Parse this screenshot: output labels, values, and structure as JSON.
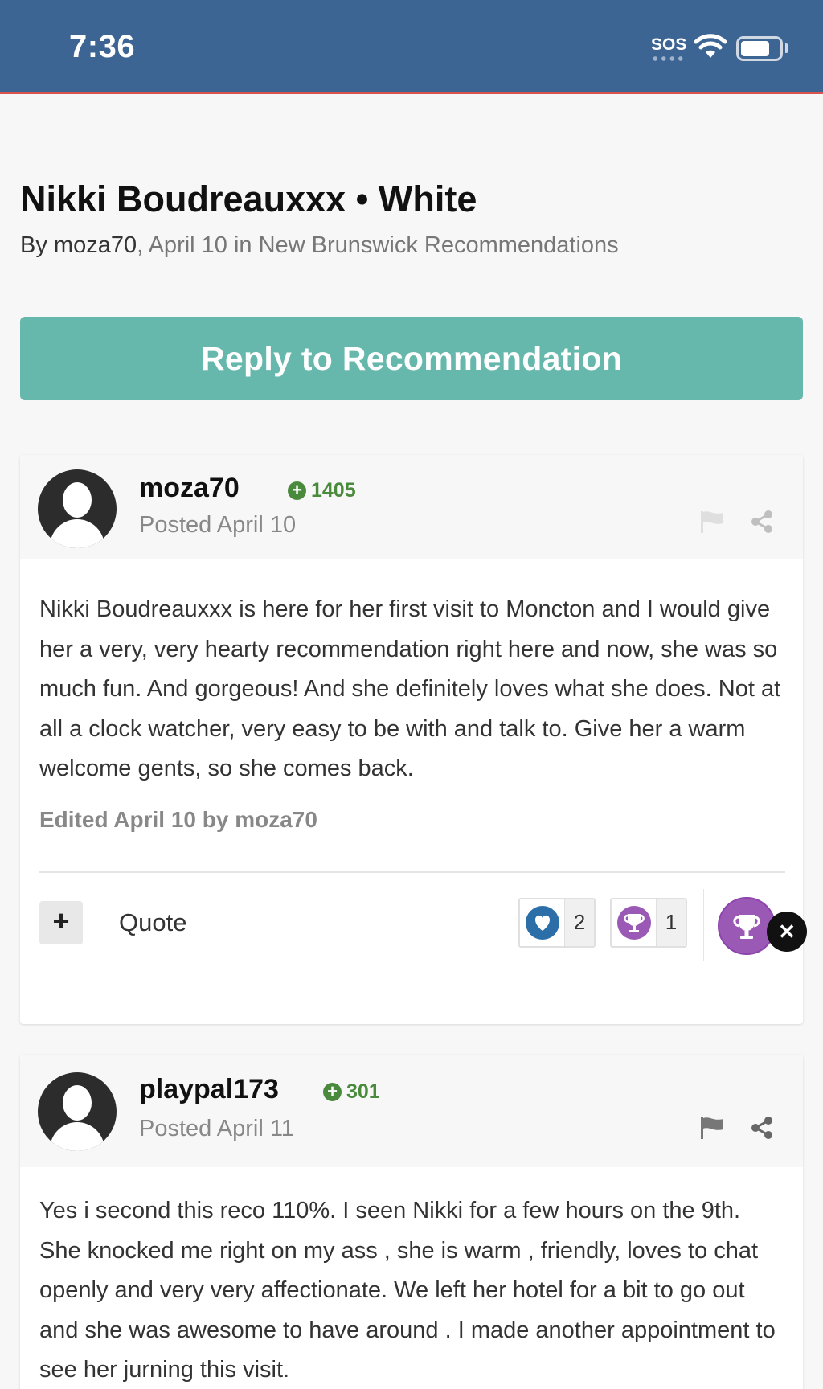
{
  "status_bar": {
    "time": "7:36",
    "sos": "SOS"
  },
  "topic": {
    "title": "Nikki Boudreauxxx • White",
    "by_prefix": "By ",
    "author": "moza70",
    "meta": ", April 10 in New Brunswick Recommendations"
  },
  "reply_button": {
    "label": "Reply to Recommendation"
  },
  "posts": [
    {
      "username": "moza70",
      "reputation": "1405",
      "posted": "Posted April 10",
      "body": "Nikki Boudreauxxx is here for her first visit to Moncton and I would give her a very, very hearty recommendation right here and now, she was so much fun. And gorgeous! And she definitely loves what she does. Not at all a clock watcher, very easy to be with and talk to. Give her a warm welcome gents, so she comes back.",
      "edited": "Edited April 10 by moza70",
      "plus_label": "+",
      "quote_label": "Quote",
      "reactions": [
        {
          "icon": "heart-icon",
          "count": "2"
        },
        {
          "icon": "trophy-icon",
          "count": "1"
        }
      ]
    },
    {
      "username": "playpal173",
      "reputation": "301",
      "posted": "Posted April 11",
      "body": "Yes i second this reco 110%.  I seen Nikki for a few hours on the 9th. She knocked me right on my ass , she is warm , friendly, loves to chat openly and very very affectionate.  We left her hotel for a bit to go out and she was awesome to have around . I made another appointment to see her jurning this visit."
    }
  ],
  "close_button": {
    "label": "✕"
  },
  "colors": {
    "header_bg": "#3d6594",
    "accent_button": "#67b8ac",
    "reputation_green": "#4a8a3c",
    "trophy_purple": "#9b59b6",
    "heart_blue": "#2b6ea8"
  }
}
